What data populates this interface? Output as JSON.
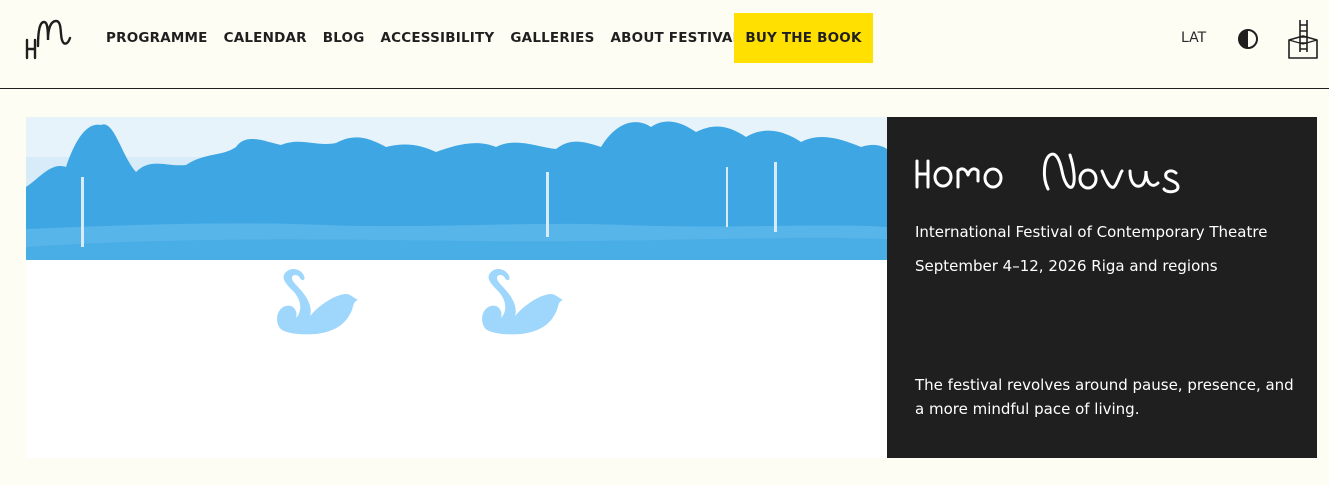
{
  "header": {
    "logo_icon": "hn-monogram-logo",
    "nav": [
      {
        "label": "PROGRAMME"
      },
      {
        "label": "CALENDAR"
      },
      {
        "label": "BLOG"
      },
      {
        "label": "ACCESSIBILITY"
      },
      {
        "label": "GALLERIES"
      },
      {
        "label": "ABOUT FESTIVAL"
      }
    ],
    "buy_label": "BUY THE BOOK",
    "lang_label": "LAT",
    "contrast_icon": "contrast-icon",
    "house_icon": "house-ladder-icon"
  },
  "hero": {
    "image": "blue-landscape-with-trees",
    "swans": [
      "swan-icon",
      "swan-icon"
    ],
    "brand": "Homo Novus",
    "subtitle": "International Festival of Contemporary Theatre",
    "dates": "September 4–12, 2026 Riga and regions",
    "description": "The festival revolves around pause, presence, and a more mindful pace of living."
  },
  "colors": {
    "background": "#fefdf4",
    "text": "#1f1f1f",
    "accent": "#ffe000",
    "panel": "#1f1f1f",
    "landscape_blue": "#4fb0e6",
    "swan_blue": "#9ed7fb"
  }
}
